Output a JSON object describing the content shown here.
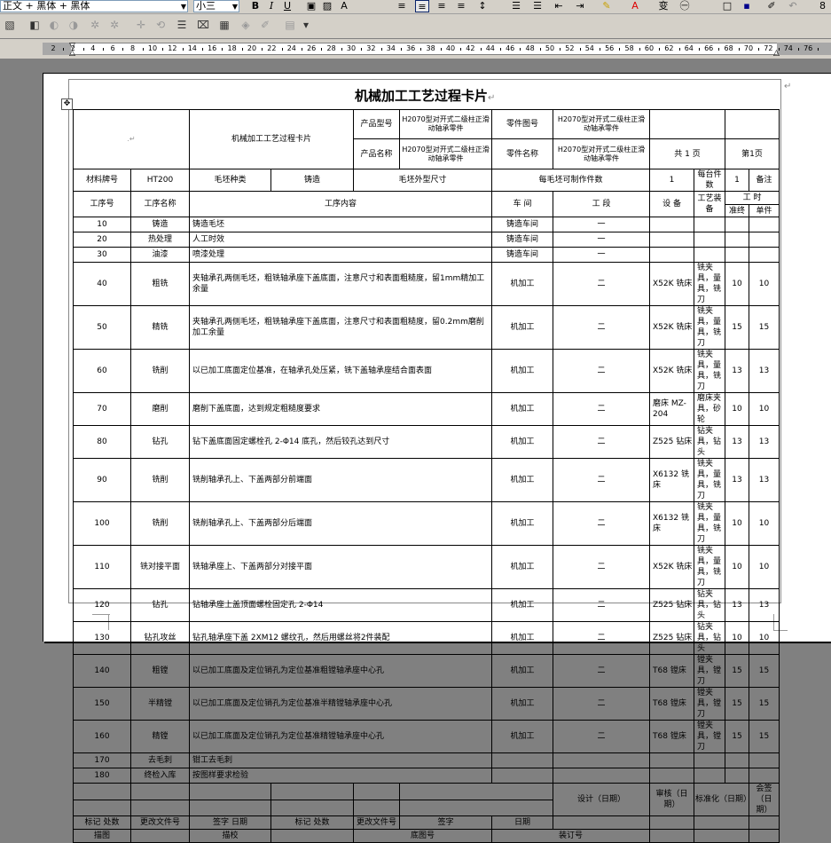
{
  "toolbar": {
    "style_value": "正文 + 黑体 + 黑体",
    "size_value": "小三",
    "top_right": "8"
  },
  "ruler": {
    "ticks": [
      "2",
      "2",
      "4",
      "6",
      "8",
      "10",
      "12",
      "14",
      "16",
      "18",
      "20",
      "22",
      "24",
      "26",
      "28",
      "30",
      "32",
      "34",
      "36",
      "38",
      "40",
      "42",
      "44",
      "46",
      "48",
      "50",
      "52",
      "54",
      "56",
      "58",
      "60",
      "62",
      "64",
      "66",
      "68",
      "70",
      "72",
      "74",
      "76"
    ]
  },
  "document": {
    "title": "机械加工工艺过程卡片",
    "paragraph_mark": "↵"
  },
  "card": {
    "header": {
      "left_blank": "",
      "card_name": "机械加工工艺过程卡片",
      "product_model_label": "产品型号",
      "product_model_value": "H2070型对开式二级柱正滑动轴承零件",
      "part_drawing_label": "零件图号",
      "part_drawing_value": "H2070型对开式二级柱正滑动轴承零件",
      "product_name_label": "产品名称",
      "product_name_value": "H2070型对开式二级柱正滑动轴承零件",
      "part_name_label": "零件名称",
      "part_name_value": "H2070型对开式二级柱正滑动轴承零件",
      "total_pages": "共  1 页",
      "page_no": "第1页"
    },
    "material": {
      "grade_label": "材料牌号",
      "grade_value": "HT200",
      "blank_type_label": "毛坯种类",
      "blank_type_value": "铸造",
      "blank_size_label": "毛坯外型尺寸",
      "per_blank_label": "每毛坯可制作件数",
      "per_blank_value": "1",
      "per_unit_label": "每台件数",
      "per_unit_value": "1",
      "remark_label": "备注"
    },
    "columns": {
      "no": "工序号",
      "name": "工序名称",
      "content": "工序内容",
      "workshop": "车 间",
      "section": "工 段",
      "equipment": "设 备",
      "tooling": "工艺装备",
      "hours": "工 时",
      "prep": "准终",
      "unit": "单件"
    },
    "rows": [
      {
        "no": "10",
        "name": "铸造",
        "content": "铸造毛坯",
        "workshop": "铸造车间",
        "section": "一",
        "equipment": "",
        "tooling": "",
        "prep": "",
        "unit": ""
      },
      {
        "no": "20",
        "name": "热处理",
        "content": "人工时效",
        "workshop": "铸造车间",
        "section": "一",
        "equipment": "",
        "tooling": "",
        "prep": "",
        "unit": ""
      },
      {
        "no": "30",
        "name": "油漆",
        "content": "喷漆处理",
        "workshop": "铸造车间",
        "section": "一",
        "equipment": "",
        "tooling": "",
        "prep": "",
        "unit": ""
      },
      {
        "no": "40",
        "name": "粗铣",
        "content": "夹轴承孔两侧毛坯，粗铣轴承座下盖底面，注意尺寸和表面粗糙度，留1mm精加工余量",
        "workshop": "机加工",
        "section": "二",
        "equipment": "X52K 铣床",
        "tooling": "铣夹具，量具，铣刀",
        "prep": "10",
        "unit": "10"
      },
      {
        "no": "50",
        "name": "精铣",
        "content": "夹轴承孔两侧毛坯，粗铣轴承座下盖底面，注意尺寸和表面粗糙度，留0.2mm磨削加工余量",
        "workshop": "机加工",
        "section": "二",
        "equipment": "X52K 铣床",
        "tooling": "铣夹具，量具，铣刀",
        "prep": "15",
        "unit": "15"
      },
      {
        "no": "60",
        "name": "铣削",
        "content": "以已加工底面定位基准，在轴承孔处压紧，铣下盖轴承座结合面表面",
        "workshop": "机加工",
        "section": "二",
        "equipment": "X52K 铣床",
        "tooling": "铣夹具，量具，铣刀",
        "prep": "13",
        "unit": "13"
      },
      {
        "no": "70",
        "name": "磨削",
        "content": "磨削下盖底面，达到规定粗糙度要求",
        "workshop": "机加工",
        "section": "二",
        "equipment": "磨床 MZ-204",
        "tooling": "磨床夹具，砂轮",
        "prep": "10",
        "unit": "10"
      },
      {
        "no": "80",
        "name": "钻孔",
        "content": "钻下盖底面固定螺栓孔 2-Φ14 底孔，然后铰孔达到尺寸",
        "workshop": "机加工",
        "section": "二",
        "equipment": "Z525 钻床",
        "tooling": "钻夹具，钻头",
        "prep": "13",
        "unit": "13"
      },
      {
        "no": "90",
        "name": "铣削",
        "content": "铣削轴承孔上、下盖两部分前端面",
        "workshop": "机加工",
        "section": "二",
        "equipment": "X6132 铣床",
        "tooling": "铣夹具，量具，铣刀",
        "prep": "13",
        "unit": "13"
      },
      {
        "no": "100",
        "name": "铣削",
        "content": "铣削轴承孔上、下盖两部分后端面",
        "workshop": "机加工",
        "section": "二",
        "equipment": "X6132 铣床",
        "tooling": "铣夹具，量具，铣刀",
        "prep": "10",
        "unit": "10"
      },
      {
        "no": "110",
        "name": "铣对接平面",
        "content": "铣轴承座上、下盖两部分对接平面",
        "workshop": "机加工",
        "section": "二",
        "equipment": "X52K 铣床",
        "tooling": "铣夹具，量具，铣刀",
        "prep": "10",
        "unit": "10"
      },
      {
        "no": "120",
        "name": "钻孔",
        "content": "钻轴承座上盖顶面螺栓固定孔 2-Φ14",
        "workshop": "机加工",
        "section": "二",
        "equipment": "Z525 钻床",
        "tooling": "钻夹具，钻头",
        "prep": "13",
        "unit": "13"
      },
      {
        "no": "130",
        "name": "钻孔攻丝",
        "content": "钻孔轴承座下盖 2XM12 螺纹孔，然后用螺丝将2件装配",
        "workshop": "机加工",
        "section": "二",
        "equipment": "Z525 钻床",
        "tooling": "钻夹具，钻头",
        "prep": "10",
        "unit": "10"
      },
      {
        "no": "140",
        "name": "粗镗",
        "content": "以已加工底面及定位销孔为定位基准粗镗轴承座中心孔",
        "workshop": "机加工",
        "section": "二",
        "equipment": "T68 镗床",
        "tooling": "镗夹具，镗刀",
        "prep": "15",
        "unit": "15"
      },
      {
        "no": "150",
        "name": "半精镗",
        "content": "以已加工底面及定位销孔为定位基准半精镗轴承座中心孔",
        "workshop": "机加工",
        "section": "二",
        "equipment": "T68 镗床",
        "tooling": "镗夹具，镗刀",
        "prep": "15",
        "unit": "15"
      },
      {
        "no": "160",
        "name": "精镗",
        "content": "以已加工底面及定位销孔为定位基准精镗轴承座中心孔",
        "workshop": "机加工",
        "section": "二",
        "equipment": "T68 镗床",
        "tooling": "镗夹具，镗刀",
        "prep": "15",
        "unit": "15"
      },
      {
        "no": "170",
        "name": "去毛刺",
        "content": "钳工去毛刺",
        "workshop": "",
        "section": "",
        "equipment": "",
        "tooling": "",
        "prep": "",
        "unit": ""
      },
      {
        "no": "180",
        "name": "终检入库",
        "content": "按图样要求检验",
        "workshop": "",
        "section": "",
        "equipment": "",
        "tooling": "",
        "prep": "",
        "unit": ""
      }
    ],
    "sign": {
      "design": "设计（日期）",
      "review": "审核（日期）",
      "standard": "标准化（日期）",
      "countersign": "会签（日期）",
      "mark": "标记",
      "count": "处数",
      "change_doc": "更改文件号",
      "signature": "签字",
      "date": "日期"
    },
    "footer": {
      "drawing": "描图",
      "tracing": "描校",
      "base_no": "底图号",
      "binding_no": "装订号"
    }
  }
}
